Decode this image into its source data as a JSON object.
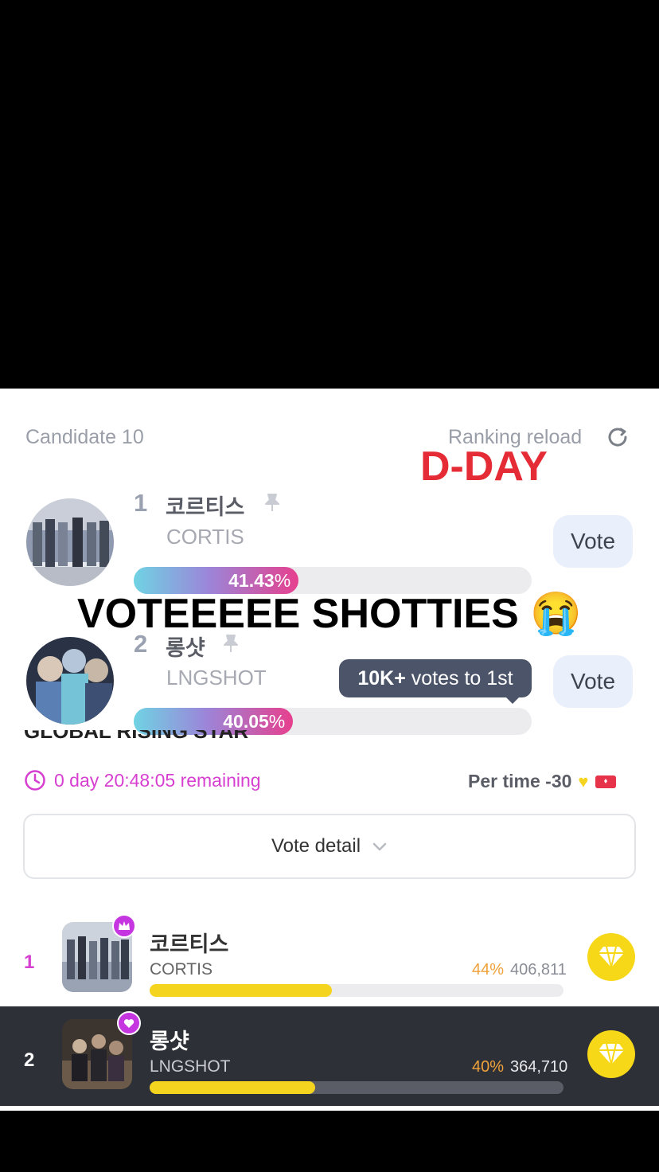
{
  "header": {
    "candidate_label": "Candidate 10",
    "ranking_reload_label": "Ranking reload",
    "dday_label": "D-DAY"
  },
  "top_candidates": [
    {
      "rank": "1",
      "name_kr": "코르티스",
      "name_en": "CORTIS",
      "percent": "41.43",
      "percent_value": 41.43,
      "vote_label": "Vote"
    },
    {
      "rank": "2",
      "name_kr": "롱샷",
      "name_en": "LNGSHOT",
      "percent": "40.05",
      "percent_value": 40.05,
      "vote_label": "Vote"
    }
  ],
  "percent_sign": "%",
  "overlay_caption": "VOTEEEEE SHOTTIES 😭",
  "tooltip": {
    "bold": "10K+",
    "text": " votes to 1st"
  },
  "event": {
    "title": "GLOBAL RISING STAR",
    "remaining": "0 day 20:48:05 remaining",
    "per_time": "Per time -30"
  },
  "vote_detail_label": "Vote detail",
  "ranking_list": [
    {
      "rank": "1",
      "name_kr": "코르티스",
      "name_en": "CORTIS",
      "percent": "44%",
      "percent_value": 44,
      "votes": "406,811",
      "badge": "crown-icon"
    },
    {
      "rank": "2",
      "name_kr": "롱샷",
      "name_en": "LNGSHOT",
      "percent": "40%",
      "percent_value": 40,
      "votes": "364,710",
      "badge": "heart-icon"
    }
  ],
  "colors": {
    "accent_pink": "#d63fd0",
    "dday_red": "#e52b35",
    "gold": "#f7d819",
    "highlight_row": "#2e3037"
  }
}
